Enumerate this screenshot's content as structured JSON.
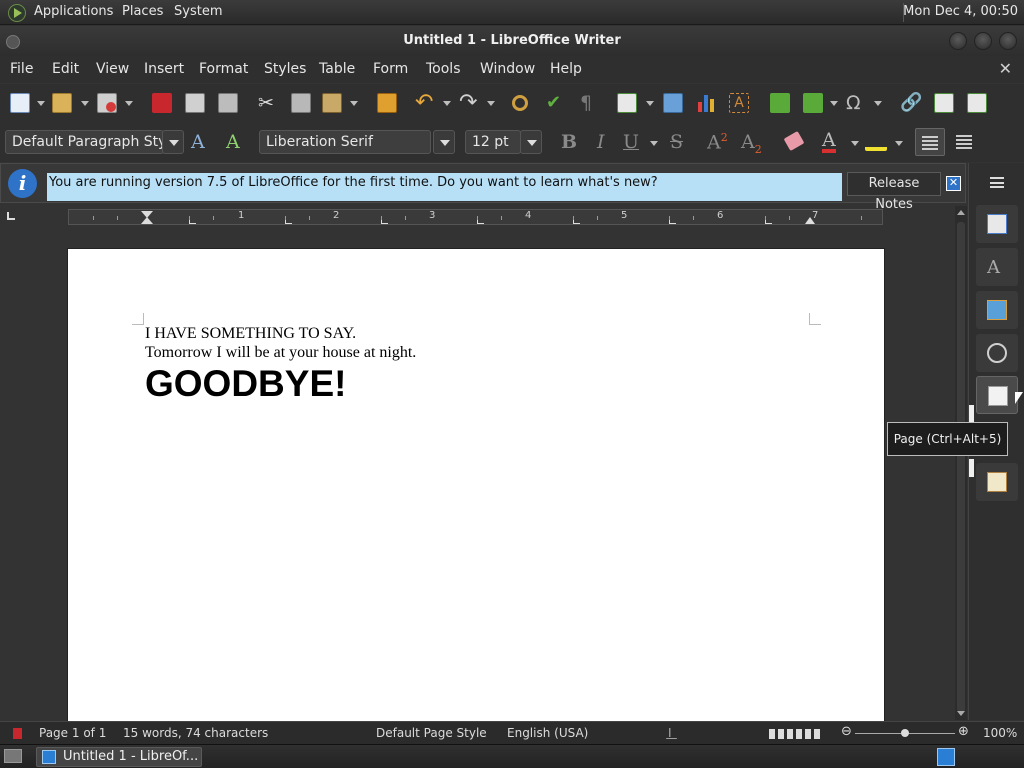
{
  "top_panel": {
    "menus": [
      "Applications",
      "Places",
      "System"
    ],
    "clock": "Mon Dec  4, 00:50"
  },
  "window": {
    "title": "Untitled 1 - LibreOffice Writer"
  },
  "menubar": {
    "items": [
      "File",
      "Edit",
      "View",
      "Insert",
      "Format",
      "Styles",
      "Table",
      "Form",
      "Tools",
      "Window",
      "Help"
    ],
    "close_doc": "✕"
  },
  "format_toolbar": {
    "paragraph_style": "Default Paragraph Style",
    "font_name": "Liberation Serif",
    "font_size": "12 pt"
  },
  "infobar": {
    "message": "You are running version 7.5 of LibreOffice for the first time. Do you want to learn what's new?",
    "button": "Release Notes",
    "icon_letter": "i"
  },
  "ruler": {
    "numbers": [
      "1",
      "2",
      "3",
      "4",
      "5",
      "6",
      "7"
    ]
  },
  "document": {
    "line1": "I HAVE SOMETHING TO SAY.",
    "line2": "Tomorrow I will be at your house at night.",
    "heading": "GOODBYE!"
  },
  "sidebar": {
    "tooltip": "Page (Ctrl+Alt+5)"
  },
  "statusbar": {
    "page": "Page 1 of 1",
    "words": "15 words, 74 characters",
    "page_style": "Default Page Style",
    "language": "English (USA)",
    "zoom": "100%",
    "zoom_minus": "⊖",
    "zoom_plus": "⊕"
  },
  "taskbar": {
    "task_label": "Untitled 1 - LibreOf..."
  },
  "colors": {
    "infobar_highlight": "#b7e0f7",
    "info_icon": "#2f73c8",
    "panel_bg": "#2f2f2f"
  }
}
